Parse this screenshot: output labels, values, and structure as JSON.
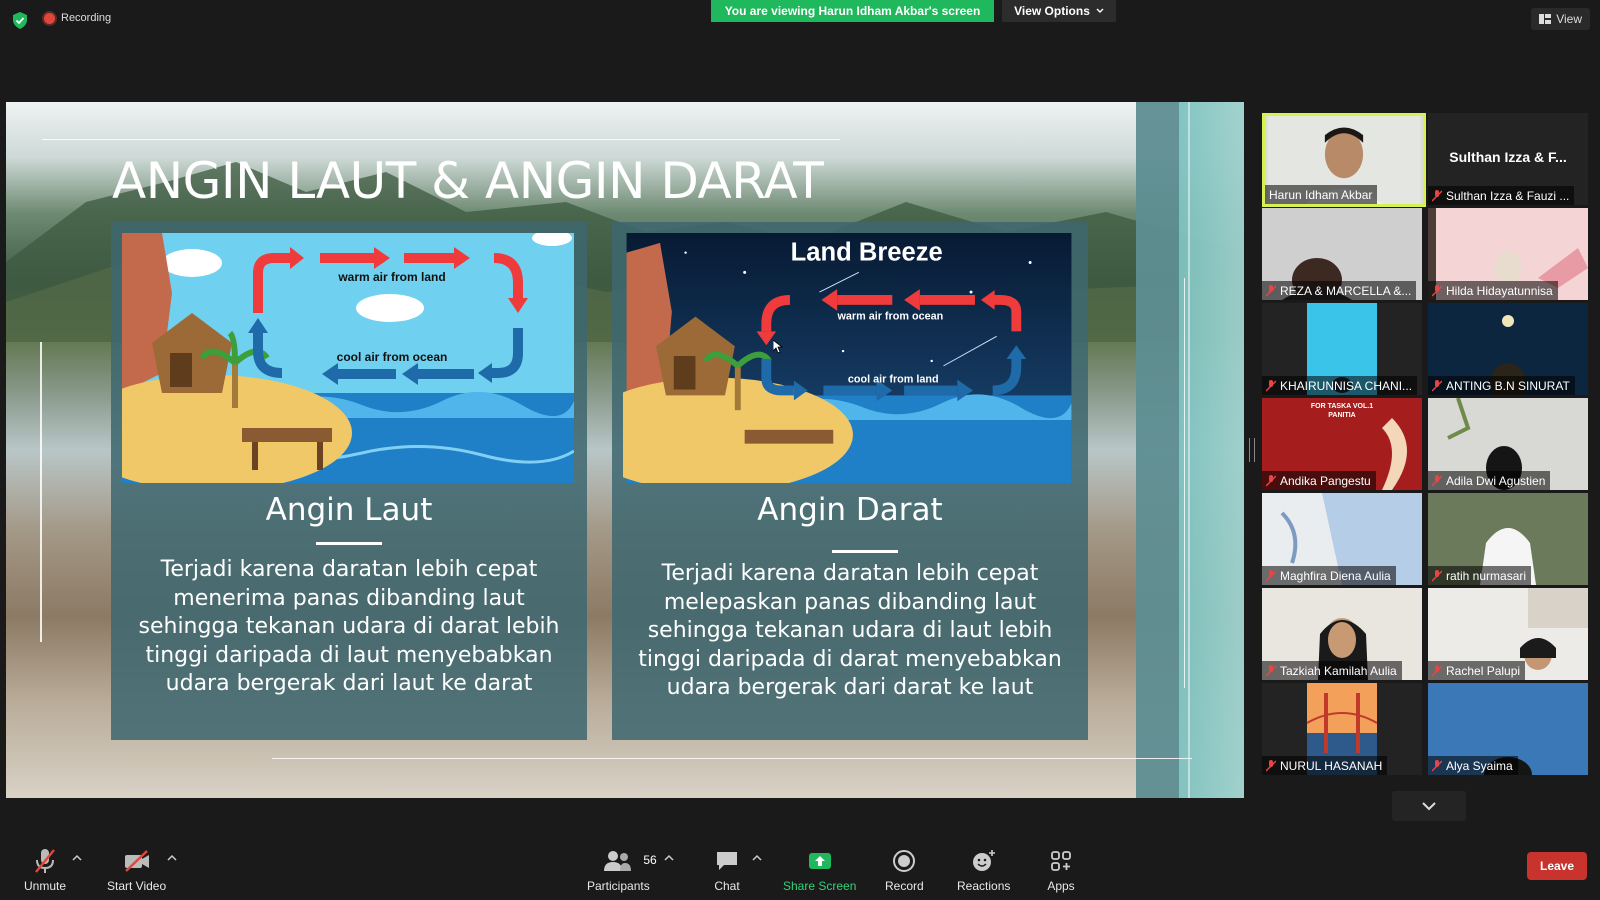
{
  "top_bar": {
    "recording_label": "Recording",
    "viewing_banner": "You are viewing Harun Idham Akbar's screen",
    "view_options_label": "View Options",
    "view_label": "View"
  },
  "slide": {
    "title": "ANGIN LAUT & ANGIN DARAT",
    "left_card": {
      "heading": "Angin Laut",
      "body": "Terjadi karena daratan lebih cepat menerima panas dibanding laut sehingga tekanan udara di darat lebih tinggi daripada di laut menyebabkan udara bergerak dari laut ke darat",
      "diagram_top_label": "warm air from land",
      "diagram_bottom_label": "cool air from ocean"
    },
    "right_card": {
      "heading": "Angin Darat",
      "body": "Terjadi karena daratan lebih cepat melepaskan panas dibanding laut sehingga tekanan udara di laut lebih tinggi daripada di darat menyebabkan udara bergerak dari darat ke laut",
      "diagram_title": "Land Breeze",
      "diagram_top_label": "warm air from ocean",
      "diagram_bottom_label": "cool air from land"
    }
  },
  "participants": [
    {
      "name": "Harun Idham Akbar",
      "active": true,
      "muted": false
    },
    {
      "name": "Sulthan Izza & Fauzi ...",
      "display": "Sulthan Izza & F...",
      "muted": true
    },
    {
      "name": "REZA & MARCELLA &...",
      "muted": true
    },
    {
      "name": "Hilda Hidayatunnisa",
      "muted": true
    },
    {
      "name": "KHAIRUNNISA CHANI...",
      "muted": true
    },
    {
      "name": "ANTING B.N SINURAT",
      "muted": true
    },
    {
      "name": "Andika Pangestu",
      "muted": true,
      "poster_text": "FOR TASKA VOL.1 PANITIA"
    },
    {
      "name": "Adila Dwi Agustien",
      "muted": true
    },
    {
      "name": "Maghfira Diena Aulia",
      "muted": true
    },
    {
      "name": "ratih nurmasari",
      "muted": true
    },
    {
      "name": "Tazkiah Kamilah Aulia",
      "muted": true
    },
    {
      "name": "Rachel Palupi",
      "muted": true
    },
    {
      "name": "NURUL HASANAH",
      "muted": true
    },
    {
      "name": "Alya Syaima",
      "muted": true
    }
  ],
  "toolbar": {
    "unmute": "Unmute",
    "start_video": "Start Video",
    "participants": "Participants",
    "participants_count": "56",
    "chat": "Chat",
    "share_screen": "Share Screen",
    "record": "Record",
    "reactions": "Reactions",
    "apps": "Apps",
    "leave": "Leave"
  },
  "colors": {
    "share_green": "#1fb85c",
    "leave_red": "#c9332d",
    "active_speaker": "#d6f250"
  }
}
